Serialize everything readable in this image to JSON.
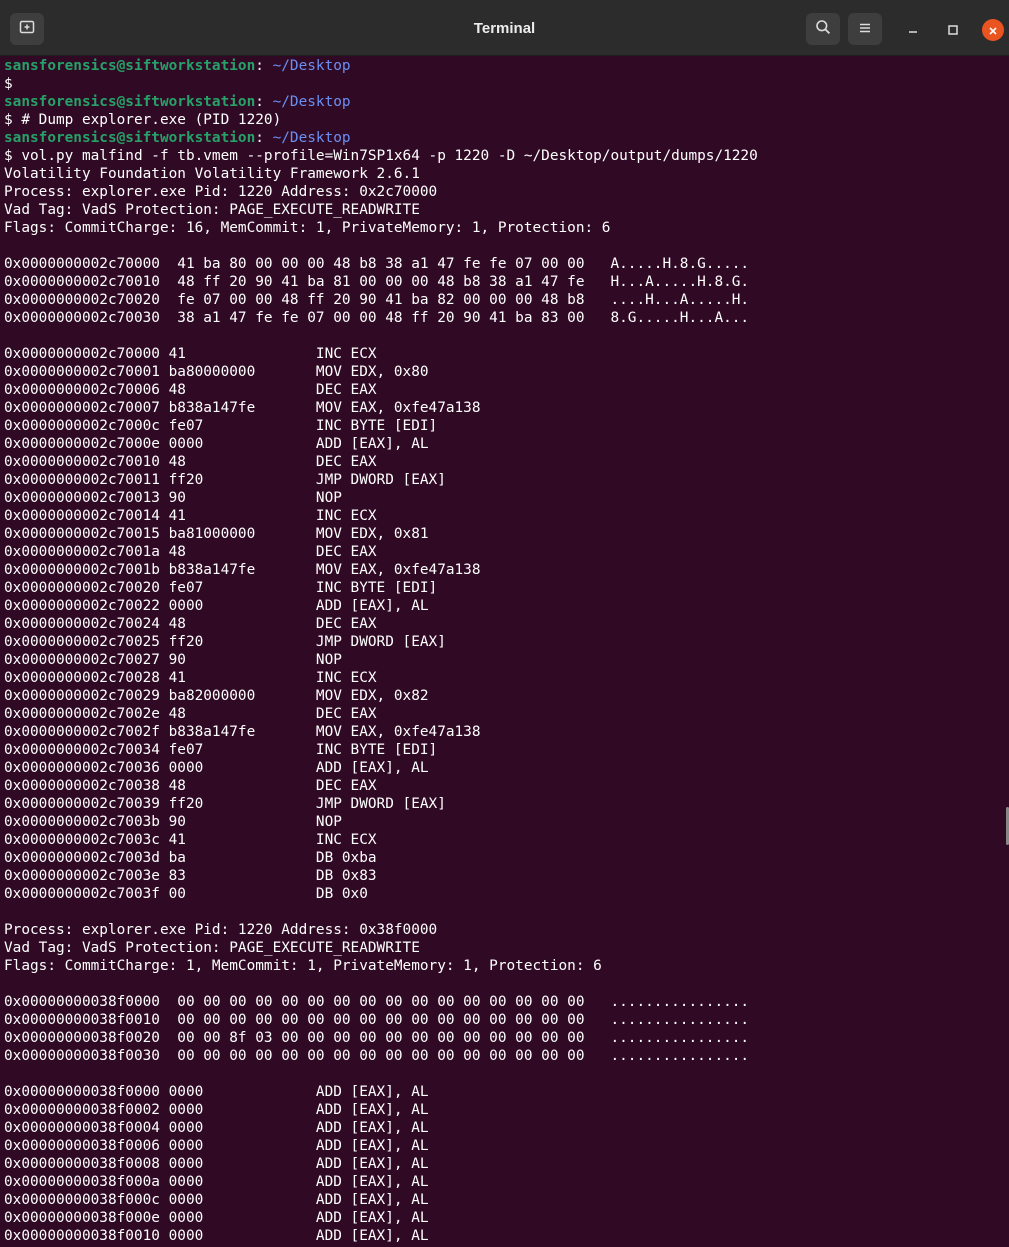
{
  "window": {
    "title": "Terminal",
    "icons": {
      "new_tab": "new-tab-icon",
      "search": "search-icon",
      "menu": "hamburger-menu-icon",
      "minimize": "minimize-icon",
      "maximize": "maximize-icon",
      "close": "close-icon"
    },
    "colors": {
      "terminal_bg": "#300a24",
      "titlebar_bg": "#2c2c2c",
      "prompt_user": "#26a269",
      "prompt_path": "#6a8ff5",
      "close_button": "#e95420"
    }
  },
  "prompts": [
    {
      "user": "sansforensics@siftworkstation",
      "sep": ":",
      "path": " ~/Desktop",
      "cmd": "$ "
    },
    {
      "user": "sansforensics@siftworkstation",
      "sep": ":",
      "path": " ~/Desktop",
      "cmd": "$ # Dump explorer.exe (PID 1220)"
    },
    {
      "user": "sansforensics@siftworkstation",
      "sep": ":",
      "path": " ~/Desktop",
      "cmd": "$ vol.py malfind -f tb.vmem --profile=Win7SP1x64 -p 1220 -D ~/Desktop/output/dumps/1220"
    }
  ],
  "output": [
    "Volatility Foundation Volatility Framework 2.6.1",
    "Process: explorer.exe Pid: 1220 Address: 0x2c70000",
    "Vad Tag: VadS Protection: PAGE_EXECUTE_READWRITE",
    "Flags: CommitCharge: 16, MemCommit: 1, PrivateMemory: 1, Protection: 6",
    "",
    "0x0000000002c70000  41 ba 80 00 00 00 48 b8 38 a1 47 fe fe 07 00 00   A.....H.8.G.....",
    "0x0000000002c70010  48 ff 20 90 41 ba 81 00 00 00 48 b8 38 a1 47 fe   H...A.....H.8.G.",
    "0x0000000002c70020  fe 07 00 00 48 ff 20 90 41 ba 82 00 00 00 48 b8   ....H...A.....H.",
    "0x0000000002c70030  38 a1 47 fe fe 07 00 00 48 ff 20 90 41 ba 83 00   8.G.....H...A...",
    "",
    "0x0000000002c70000 41               INC ECX",
    "0x0000000002c70001 ba80000000       MOV EDX, 0x80",
    "0x0000000002c70006 48               DEC EAX",
    "0x0000000002c70007 b838a147fe       MOV EAX, 0xfe47a138",
    "0x0000000002c7000c fe07             INC BYTE [EDI]",
    "0x0000000002c7000e 0000             ADD [EAX], AL",
    "0x0000000002c70010 48               DEC EAX",
    "0x0000000002c70011 ff20             JMP DWORD [EAX]",
    "0x0000000002c70013 90               NOP",
    "0x0000000002c70014 41               INC ECX",
    "0x0000000002c70015 ba81000000       MOV EDX, 0x81",
    "0x0000000002c7001a 48               DEC EAX",
    "0x0000000002c7001b b838a147fe       MOV EAX, 0xfe47a138",
    "0x0000000002c70020 fe07             INC BYTE [EDI]",
    "0x0000000002c70022 0000             ADD [EAX], AL",
    "0x0000000002c70024 48               DEC EAX",
    "0x0000000002c70025 ff20             JMP DWORD [EAX]",
    "0x0000000002c70027 90               NOP",
    "0x0000000002c70028 41               INC ECX",
    "0x0000000002c70029 ba82000000       MOV EDX, 0x82",
    "0x0000000002c7002e 48               DEC EAX",
    "0x0000000002c7002f b838a147fe       MOV EAX, 0xfe47a138",
    "0x0000000002c70034 fe07             INC BYTE [EDI]",
    "0x0000000002c70036 0000             ADD [EAX], AL",
    "0x0000000002c70038 48               DEC EAX",
    "0x0000000002c70039 ff20             JMP DWORD [EAX]",
    "0x0000000002c7003b 90               NOP",
    "0x0000000002c7003c 41               INC ECX",
    "0x0000000002c7003d ba               DB 0xba",
    "0x0000000002c7003e 83               DB 0x83",
    "0x0000000002c7003f 00               DB 0x0",
    "",
    "Process: explorer.exe Pid: 1220 Address: 0x38f0000",
    "Vad Tag: VadS Protection: PAGE_EXECUTE_READWRITE",
    "Flags: CommitCharge: 1, MemCommit: 1, PrivateMemory: 1, Protection: 6",
    "",
    "0x00000000038f0000  00 00 00 00 00 00 00 00 00 00 00 00 00 00 00 00   ................",
    "0x00000000038f0010  00 00 00 00 00 00 00 00 00 00 00 00 00 00 00 00   ................",
    "0x00000000038f0020  00 00 8f 03 00 00 00 00 00 00 00 00 00 00 00 00   ................",
    "0x00000000038f0030  00 00 00 00 00 00 00 00 00 00 00 00 00 00 00 00   ................",
    "",
    "0x00000000038f0000 0000             ADD [EAX], AL",
    "0x00000000038f0002 0000             ADD [EAX], AL",
    "0x00000000038f0004 0000             ADD [EAX], AL",
    "0x00000000038f0006 0000             ADD [EAX], AL",
    "0x00000000038f0008 0000             ADD [EAX], AL",
    "0x00000000038f000a 0000             ADD [EAX], AL",
    "0x00000000038f000c 0000             ADD [EAX], AL",
    "0x00000000038f000e 0000             ADD [EAX], AL",
    "0x00000000038f0010 0000             ADD [EAX], AL"
  ]
}
